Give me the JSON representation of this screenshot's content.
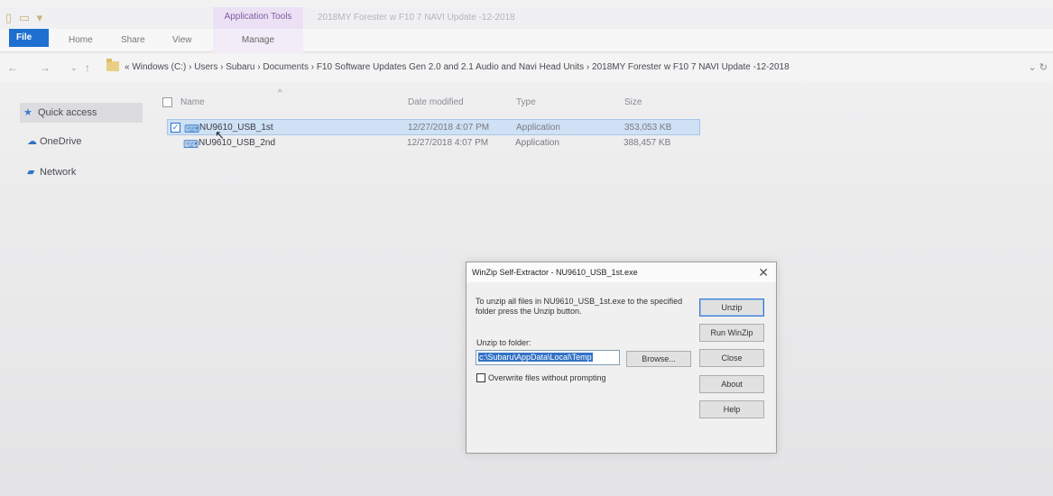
{
  "titlebar": {
    "context_tab_header": "Application Tools",
    "window_title": "2018MY Forester w F10 7 NAVI Update -12-2018"
  },
  "ribbon": {
    "tabs": [
      "File",
      "Home",
      "Share",
      "View"
    ],
    "context_tab": "Manage"
  },
  "address": {
    "path": "« Windows (C:)  ›  Users  ›  Subaru  ›  Documents  ›  F10 Software Updates Gen 2.0 and 2.1 Audio and Navi Head Units  ›  2018MY Forester w F10 7 NAVI Update -12-2018"
  },
  "navpane": {
    "items": [
      "Quick access",
      "OneDrive",
      "Network"
    ]
  },
  "filelist": {
    "columns": [
      "Name",
      "Date modified",
      "Type",
      "Size"
    ],
    "rows": [
      {
        "name": "NU9610_USB_1st",
        "date": "12/27/2018 4:07 PM",
        "type": "Application",
        "size": "353,053 KB"
      },
      {
        "name": "NU9610_USB_2nd",
        "date": "12/27/2018 4:07 PM",
        "type": "Application",
        "size": "388,457 KB"
      }
    ]
  },
  "dialog": {
    "title": "WinZip Self-Extractor - NU9610_USB_1st.exe",
    "message": "To unzip all files in NU9610_USB_1st.exe to the specified folder press the Unzip button.",
    "folder_label": "Unzip to folder:",
    "folder_value": "c:\\Subaru\\AppData\\Local\\Temp",
    "browse_label": "Browse...",
    "overwrite_label": "Overwrite files without prompting",
    "buttons": [
      "Unzip",
      "Run WinZip",
      "Close",
      "About",
      "Help"
    ]
  }
}
